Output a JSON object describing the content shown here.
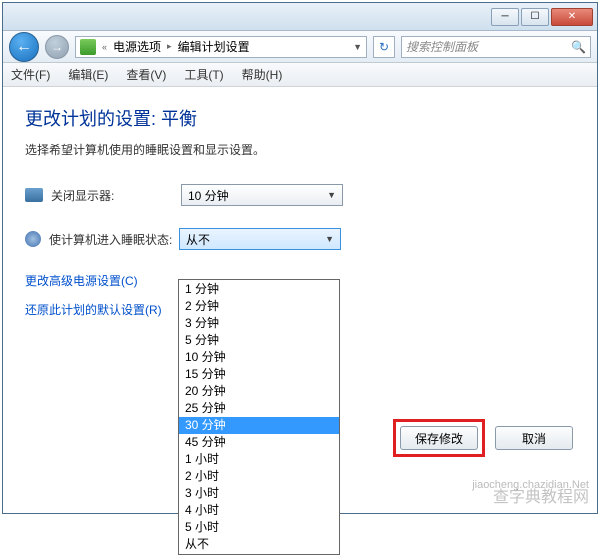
{
  "titlebar": {
    "min_glyph": "─",
    "max_glyph": "☐",
    "close_glyph": "✕"
  },
  "breadcrumb": {
    "parent": "电源选项",
    "current": "编辑计划设置"
  },
  "search": {
    "placeholder": "搜索控制面板"
  },
  "menu": {
    "file": "文件(F)",
    "edit": "编辑(E)",
    "view": "查看(V)",
    "tools": "工具(T)",
    "help": "帮助(H)"
  },
  "page": {
    "title": "更改计划的设置: 平衡",
    "subtitle": "选择希望计算机使用的睡眠设置和显示设置。"
  },
  "settings": {
    "display_off_label": "关闭显示器:",
    "display_off_value": "10 分钟",
    "sleep_label": "使计算机进入睡眠状态:",
    "sleep_value": "从不"
  },
  "links": {
    "advanced": "更改高级电源设置(C)",
    "restore": "还原此计划的默认设置(R)"
  },
  "dropdown_options": [
    "1 分钟",
    "2 分钟",
    "3 分钟",
    "5 分钟",
    "10 分钟",
    "15 分钟",
    "20 分钟",
    "25 分钟",
    "30 分钟",
    "45 分钟",
    "1 小时",
    "2 小时",
    "3 小时",
    "4 小时",
    "5 小时",
    "从不"
  ],
  "dropdown_selected": "30 分钟",
  "buttons": {
    "save": "保存修改",
    "cancel": "取消"
  },
  "watermark": {
    "line1": "查字典教程网",
    "line2": "jiaocheng.chazidian.Net"
  },
  "arrows": {
    "left": "←",
    "right": "→",
    "down": "▼",
    "sep": "▸",
    "refresh": "↻",
    "double_left": "«",
    "mag": "🔍"
  }
}
